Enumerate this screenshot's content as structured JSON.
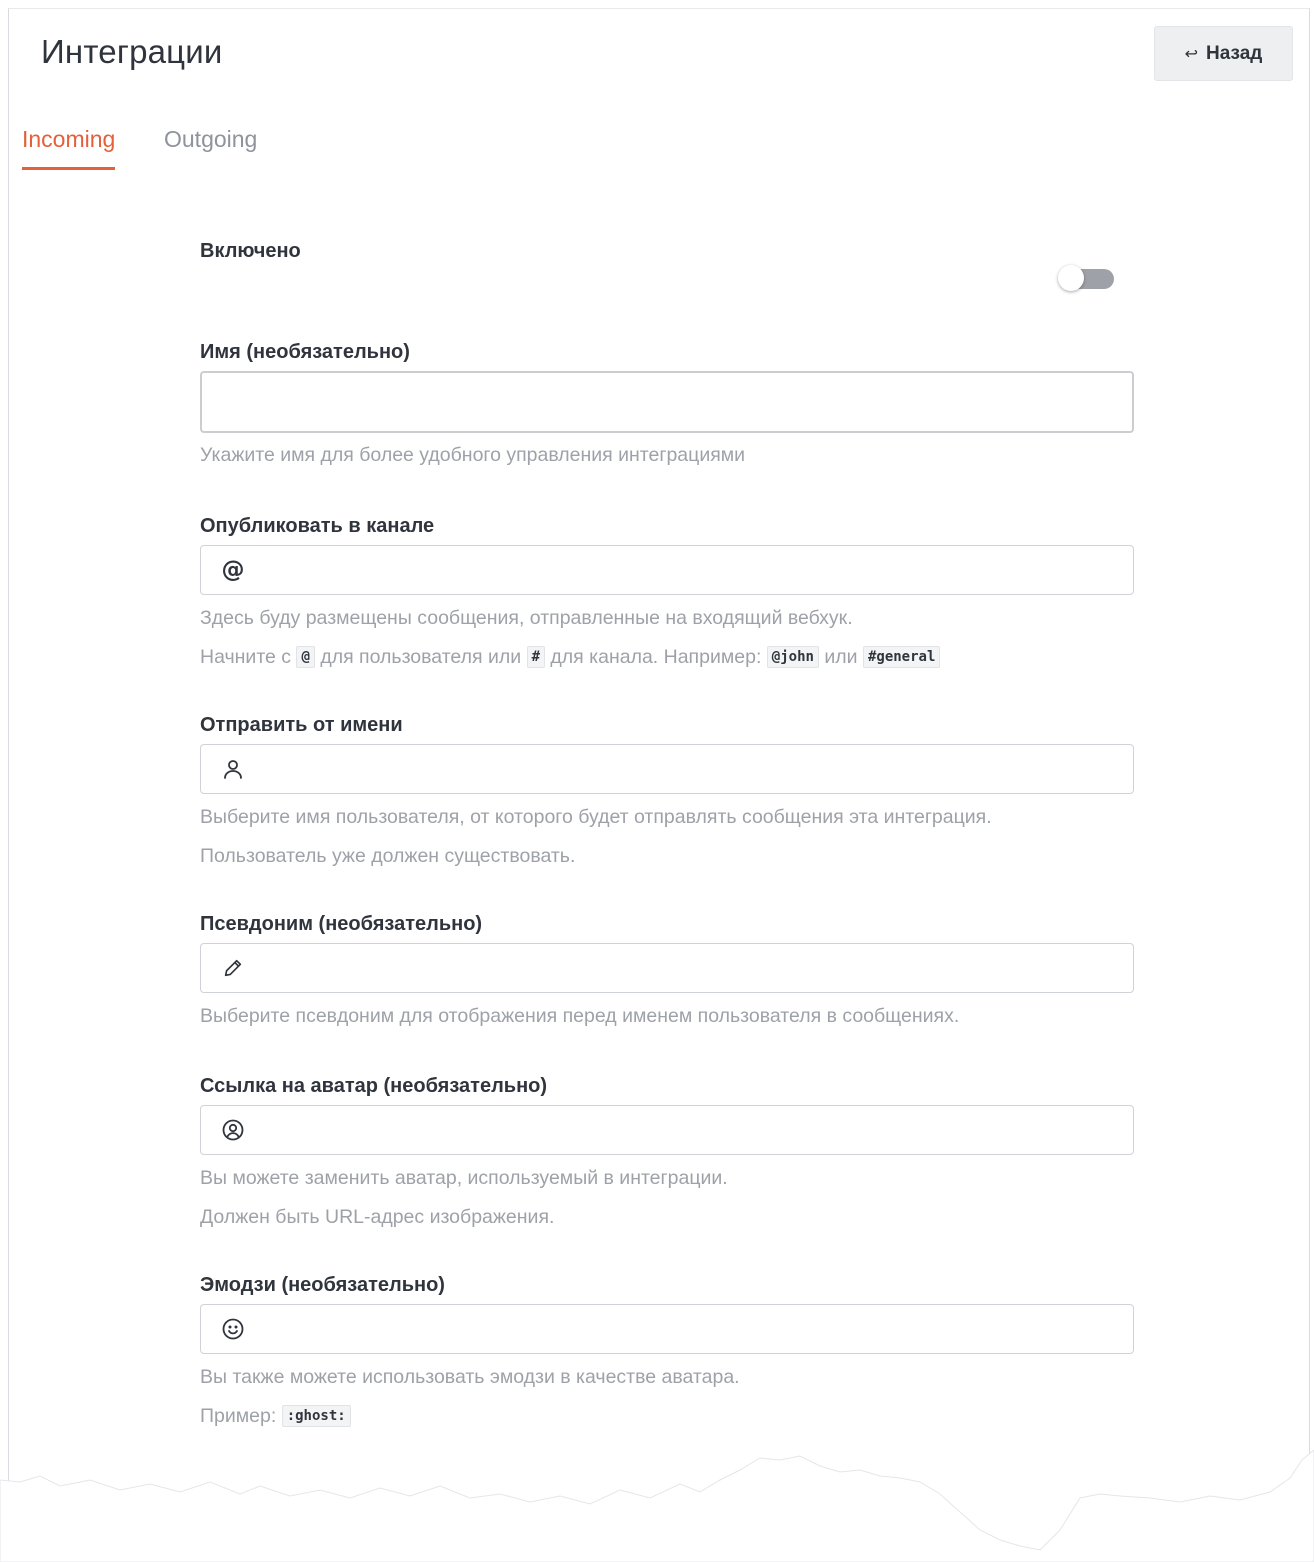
{
  "header": {
    "title": "Интеграции",
    "back_label": "Назад",
    "back_icon": "↩"
  },
  "tabs": [
    {
      "label": "Incoming",
      "active": true
    },
    {
      "label": "Outgoing",
      "active": false
    }
  ],
  "form": {
    "enabled": {
      "label": "Включено",
      "value": false
    },
    "name": {
      "label": "Имя (необязательно)",
      "value": "",
      "hint": "Укажите имя для более удобного управления интеграциями"
    },
    "channel": {
      "label": "Опубликовать в канале",
      "icon": "at-icon",
      "value": "",
      "hint1": "Здесь буду размещены сообщения, отправленные на входящий вебхук.",
      "hint2_a": "Начните с",
      "code_at": "@",
      "hint2_b": "для пользователя или",
      "code_hash": "#",
      "hint2_c": "для канала. Например:",
      "code_john": "@john",
      "hint2_d": "или",
      "code_general": "#general"
    },
    "post_as": {
      "label": "Отправить от имени",
      "icon": "user-icon",
      "value": "",
      "hint1": "Выберите имя пользователя, от которого будет отправлять сообщения эта интеграция.",
      "hint2": "Пользователь уже должен существовать."
    },
    "alias": {
      "label": "Псевдоним (необязательно)",
      "icon": "pencil-icon",
      "value": "",
      "hint": "Выберите псевдоним для отображения перед именем пользователя в сообщениях."
    },
    "avatar": {
      "label": "Ссылка на аватар (необязательно)",
      "icon": "avatar-icon",
      "value": "",
      "hint1": "Вы можете заменить аватар, используемый в интеграции.",
      "hint2": "Должен быть URL-адрес изображения."
    },
    "emoji": {
      "label": "Эмодзи (необязательно)",
      "icon": "emoji-icon",
      "value": "",
      "hint1": "Вы также можете использовать эмодзи в качестве аватара.",
      "hint2": "Пример:",
      "code_ghost": ":ghost:"
    }
  },
  "colors": {
    "accent": "#e4603a",
    "text": "#2f343d",
    "hint": "#9ea2a8",
    "toggle_off": "#9ea2a8"
  }
}
